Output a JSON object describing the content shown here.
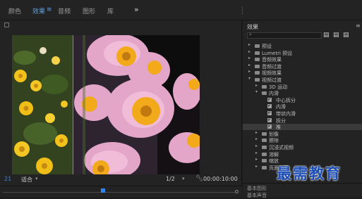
{
  "topbar": {
    "tabs": [
      {
        "label": "颜色",
        "active": false
      },
      {
        "label": "效果",
        "active": true
      },
      {
        "label": "音频",
        "active": false
      },
      {
        "label": "图形",
        "active": false
      },
      {
        "label": "库",
        "active": false
      }
    ],
    "menu_icon": "hamburger-icon",
    "more_label": "»"
  },
  "monitor": {
    "timecode_left": "21",
    "fit_label": "适合",
    "ratio_label": "1/2",
    "timecode_right": "00:00:10:00",
    "playhead_fraction": 0.42
  },
  "effects": {
    "title": "效果",
    "menu_label": "≡",
    "icons": [
      "new-bin-icon",
      "accelerated-effects-icon",
      "yuv-effects-icon"
    ],
    "tree": [
      {
        "label": "预设",
        "indent": 0,
        "type": "folder",
        "expanded": false
      },
      {
        "label": "Lumetri 预设",
        "indent": 0,
        "type": "folder",
        "expanded": false
      },
      {
        "label": "音频效果",
        "indent": 0,
        "type": "folder",
        "expanded": false
      },
      {
        "label": "音频过渡",
        "indent": 0,
        "type": "folder",
        "expanded": false
      },
      {
        "label": "视频效果",
        "indent": 0,
        "type": "folder",
        "expanded": false
      },
      {
        "label": "视频过渡",
        "indent": 0,
        "type": "folder",
        "expanded": true
      },
      {
        "label": "3D 运动",
        "indent": 1,
        "type": "folder",
        "expanded": false
      },
      {
        "label": "内滑",
        "indent": 1,
        "type": "folder",
        "expanded": true
      },
      {
        "label": "中心拆分",
        "indent": 2,
        "type": "effect"
      },
      {
        "label": "内滑",
        "indent": 2,
        "type": "effect"
      },
      {
        "label": "带状内滑",
        "indent": 2,
        "type": "effect"
      },
      {
        "label": "拆分",
        "indent": 2,
        "type": "effect"
      },
      {
        "label": "推",
        "indent": 2,
        "type": "effect",
        "selected": true
      },
      {
        "label": "划像",
        "indent": 1,
        "type": "folder",
        "expanded": false
      },
      {
        "label": "擦除",
        "indent": 1,
        "type": "folder",
        "expanded": false
      },
      {
        "label": "沉浸式视频",
        "indent": 1,
        "type": "folder",
        "expanded": false
      },
      {
        "label": "溶解",
        "indent": 1,
        "type": "folder",
        "expanded": false
      },
      {
        "label": "缩放",
        "indent": 1,
        "type": "folder",
        "expanded": false
      },
      {
        "label": "页面剥落",
        "indent": 1,
        "type": "folder",
        "expanded": false
      }
    ],
    "bottom_labels": [
      "基本图形",
      "基本声音"
    ]
  },
  "watermark": "最需教育",
  "colors": {
    "accent": "#2f86f3",
    "panel": "#232323",
    "selected_row": "#3a3a3a",
    "watermark": "#1b4db4"
  }
}
